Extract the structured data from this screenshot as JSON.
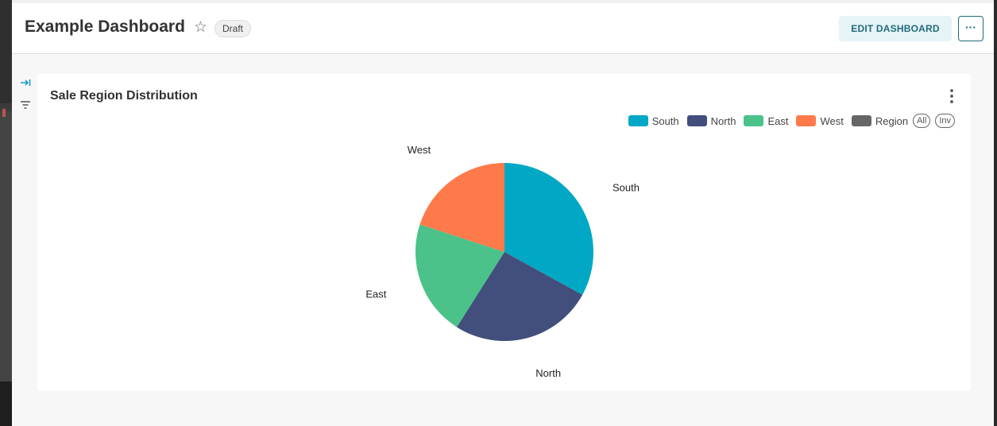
{
  "header": {
    "title": "Example Dashboard",
    "status_badge": "Draft",
    "edit_label": "EDIT DASHBOARD",
    "more_label": "···"
  },
  "card": {
    "title": "Sale Region Distribution",
    "legend_all": "All",
    "legend_inv": "Inv"
  },
  "colors": {
    "South": "#00A8C6",
    "North": "#424E7B",
    "East": "#4AC28A",
    "West": "#FF7A4A",
    "Region": "#666666"
  },
  "chart_data": {
    "type": "pie",
    "title": "Sale Region Distribution",
    "legend": [
      "South",
      "North",
      "East",
      "West",
      "Region"
    ],
    "legend_position": "top-right",
    "slices": [
      {
        "name": "South",
        "value": 33,
        "color": "#00A8C6"
      },
      {
        "name": "North",
        "value": 26,
        "color": "#424E7B"
      },
      {
        "name": "East",
        "value": 21,
        "color": "#4AC28A"
      },
      {
        "name": "West",
        "value": 20,
        "color": "#FF7A4A"
      }
    ]
  }
}
